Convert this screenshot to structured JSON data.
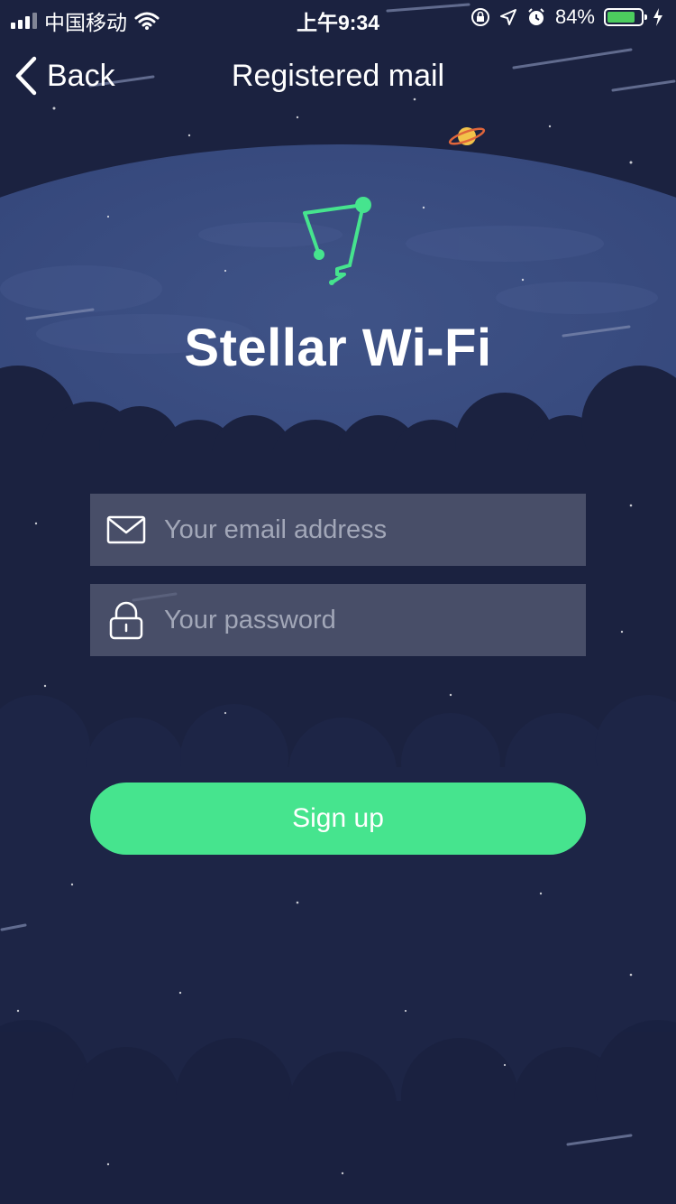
{
  "status_bar": {
    "carrier": "中国移动",
    "time": "上午9:34",
    "battery_percent": "84%",
    "battery_level": 0.84,
    "icons": [
      "signal-icon",
      "wifi-icon",
      "orientation-lock-icon",
      "location-icon",
      "alarm-icon",
      "battery-icon",
      "charging-icon"
    ]
  },
  "nav": {
    "back_label": "Back",
    "title": "Registered mail"
  },
  "brand": {
    "title": "Stellar Wi-Fi",
    "accent_color": "#46e48e"
  },
  "form": {
    "email": {
      "placeholder": "Your email address",
      "value": "",
      "icon": "envelope-icon"
    },
    "password": {
      "placeholder": "Your password",
      "value": "",
      "icon": "lock-icon"
    },
    "submit_label": "Sign up"
  },
  "colors": {
    "background": "#1b2240",
    "field_background": "#585e76",
    "button": "#46e48e"
  }
}
